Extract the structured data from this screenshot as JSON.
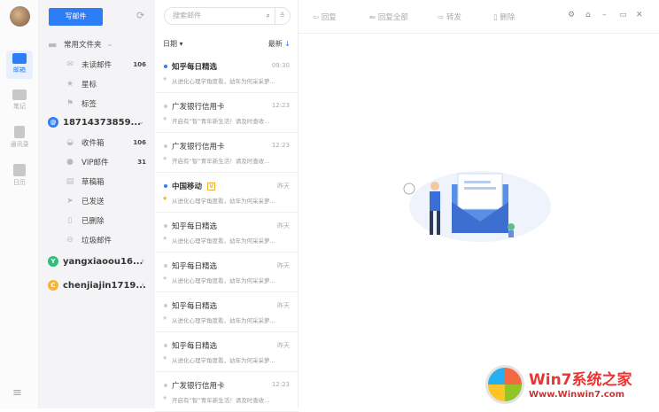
{
  "rail": {
    "items": [
      {
        "label": "邮箱",
        "active": true
      },
      {
        "label": "笔记"
      },
      {
        "label": "通讯录"
      },
      {
        "label": "日历"
      }
    ],
    "menu_icon": "hamburger-icon"
  },
  "folders": {
    "compose": "写邮件",
    "common": {
      "label": "常用文件夹",
      "items": [
        {
          "label": "未读邮件",
          "count": "106",
          "icon": "envelope-icon"
        },
        {
          "label": "星标",
          "icon": "star-icon"
        },
        {
          "label": "标签",
          "icon": "tag-icon"
        }
      ]
    },
    "accounts": [
      {
        "name": "18714373859...",
        "badge": "@",
        "color": "#2d7df6",
        "items": [
          {
            "label": "收件箱",
            "count": "106"
          },
          {
            "label": "VIP邮件",
            "count": "31"
          },
          {
            "label": "草稿箱"
          },
          {
            "label": "已发送"
          },
          {
            "label": "已删除"
          },
          {
            "label": "垃圾邮件"
          }
        ]
      },
      {
        "name": "yangxiaoou16...",
        "badge": "Y",
        "color": "#2dbf7a"
      },
      {
        "name": "chenjiajin1719...",
        "badge": "C",
        "color": "#f3b63a"
      }
    ]
  },
  "list": {
    "search_placeholder": "搜索邮件",
    "sort_label": "日期 ▾",
    "order_label": "最新",
    "order_arrow": "↓",
    "mails": [
      {
        "title": "知乎每日精选",
        "time": "09:30",
        "preview": "从进化心理学角度看，幼年为何采采萝...",
        "unread": true,
        "star": false
      },
      {
        "title": "广发银行信用卡",
        "time": "12:23",
        "preview": "开启有“智”青年新生活！请及时查收...",
        "unread": false,
        "star": false
      },
      {
        "title": "广发银行信用卡",
        "time": "12:23",
        "preview": "开启有“智”青年新生活！请及时查收...",
        "unread": false,
        "star": false
      },
      {
        "title": "中国移动",
        "time": "昨天",
        "preview": "从进化心理学角度看，幼年为何采采萝...",
        "unread": true,
        "star": true,
        "tag": "V"
      },
      {
        "title": "知乎每日精选",
        "time": "昨天",
        "preview": "从进化心理学角度看，幼年为何采采萝...",
        "unread": false,
        "star": false
      },
      {
        "title": "知乎每日精选",
        "time": "昨天",
        "preview": "从进化心理学角度看，幼年为何采采萝...",
        "unread": false,
        "star": false
      },
      {
        "title": "知乎每日精选",
        "time": "昨天",
        "preview": "从进化心理学角度看，幼年为何采采萝...",
        "unread": false,
        "star": false
      },
      {
        "title": "知乎每日精选",
        "time": "昨天",
        "preview": "从进化心理学角度看，幼年为何采采萝...",
        "unread": false,
        "star": false
      },
      {
        "title": "广发银行信用卡",
        "time": "12:23",
        "preview": "开启有“智”青年新生活！请及时查收...",
        "unread": false,
        "star": false
      }
    ]
  },
  "toolbar": {
    "reply": "回复",
    "reply_all": "回复全部",
    "forward": "转发",
    "delete": "删除"
  },
  "watermark": {
    "title": "Win7系统之家",
    "url": "Www.Winwin7.com"
  }
}
